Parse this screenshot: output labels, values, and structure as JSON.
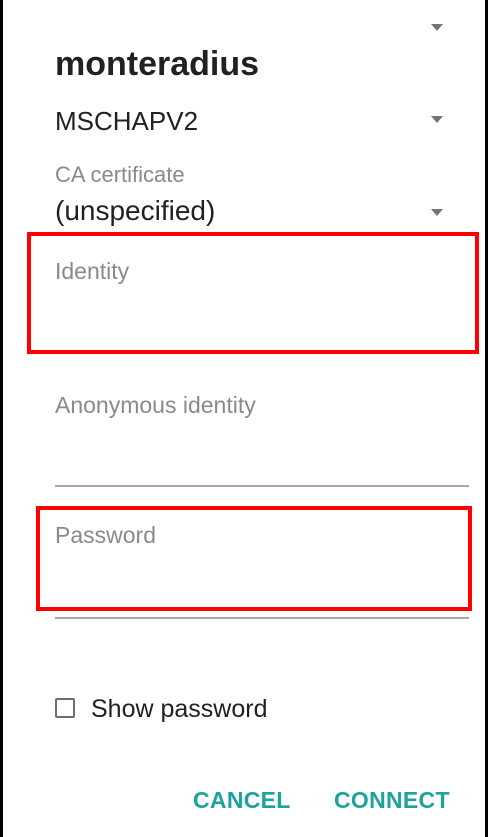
{
  "dialog": {
    "network_name": "monteradius",
    "phase2_auth": {
      "selected": "MSCHAPV2"
    },
    "ca_certificate": {
      "label": "CA certificate",
      "selected": "(unspecified)"
    },
    "identity": {
      "placeholder": "Identity",
      "value": ""
    },
    "anonymous_identity": {
      "placeholder": "Anonymous identity",
      "value": ""
    },
    "password": {
      "placeholder": "Password",
      "value": ""
    },
    "show_password": {
      "label": "Show password",
      "checked": false
    },
    "buttons": {
      "cancel": "CANCEL",
      "connect": "CONNECT"
    }
  },
  "colors": {
    "accent": "#1ba39c",
    "highlight": "#ff0000",
    "primary_text": "#212121",
    "hint_text": "#8a8a8a"
  },
  "icons": [
    "dropdown-arrow-icon",
    "checkbox-icon"
  ]
}
